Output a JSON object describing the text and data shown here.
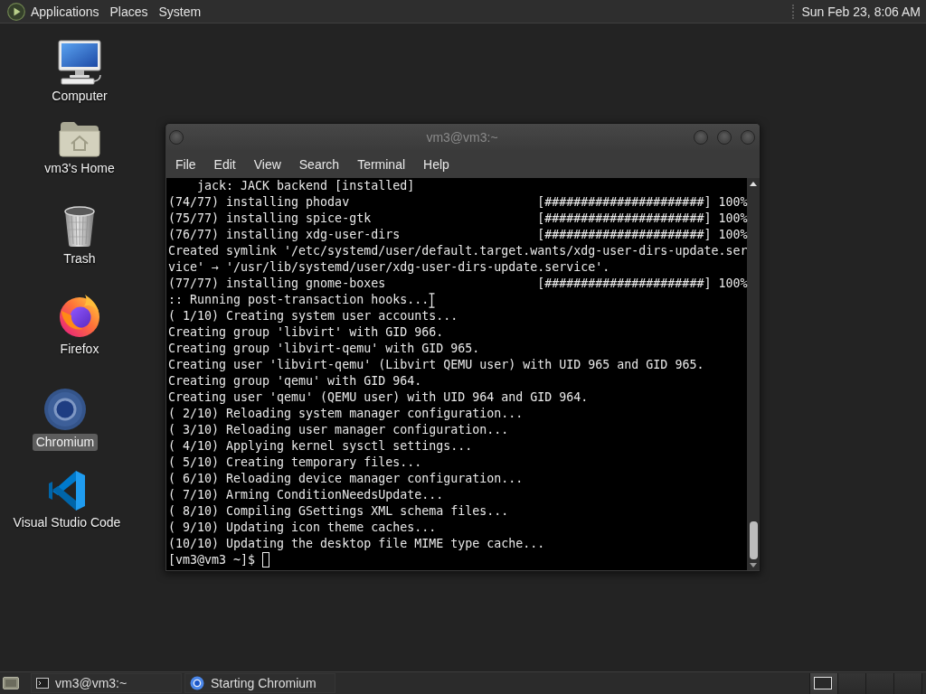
{
  "top_panel": {
    "menus": [
      "Applications",
      "Places",
      "System"
    ],
    "clock": "Sun Feb 23, 8:06 AM"
  },
  "desktop_icons": [
    {
      "kind": "computer",
      "label": "Computer",
      "selected": false
    },
    {
      "kind": "home",
      "label": "vm3's Home",
      "selected": false
    },
    {
      "kind": "trash",
      "label": "Trash",
      "selected": false
    },
    {
      "kind": "firefox",
      "label": "Firefox",
      "selected": false
    },
    {
      "kind": "chromium",
      "label": "Chromium",
      "selected": true
    },
    {
      "kind": "vscode",
      "label": "Visual Studio Code",
      "selected": false
    }
  ],
  "terminal": {
    "title": "vm3@vm3:~",
    "menu": [
      "File",
      "Edit",
      "View",
      "Search",
      "Terminal",
      "Help"
    ],
    "lines": [
      {
        "kind": "detail",
        "text": "jack: JACK backend [installed]"
      },
      {
        "kind": "progress",
        "text": "(74/77) installing phodav",
        "bar": "[######################]",
        "percent": "100%"
      },
      {
        "kind": "progress",
        "text": "(75/77) installing spice-gtk",
        "bar": "[######################]",
        "percent": "100%"
      },
      {
        "kind": "progress",
        "text": "(76/77) installing xdg-user-dirs",
        "bar": "[######################]",
        "percent": "100%"
      },
      {
        "kind": "text",
        "text": "Created symlink '/etc/systemd/user/default.target.wants/xdg-user-dirs-update.ser"
      },
      {
        "kind": "text",
        "text": "vice' → '/usr/lib/systemd/user/xdg-user-dirs-update.service'."
      },
      {
        "kind": "progress",
        "text": "(77/77) installing gnome-boxes",
        "bar": "[######################]",
        "percent": "100%"
      },
      {
        "kind": "text",
        "text": ":: Running post-transaction hooks..."
      },
      {
        "kind": "text",
        "text": "( 1/10) Creating system user accounts..."
      },
      {
        "kind": "text",
        "text": "Creating group 'libvirt' with GID 966."
      },
      {
        "kind": "text",
        "text": "Creating group 'libvirt-qemu' with GID 965."
      },
      {
        "kind": "text",
        "text": "Creating user 'libvirt-qemu' (Libvirt QEMU user) with UID 965 and GID 965."
      },
      {
        "kind": "text",
        "text": "Creating group 'qemu' with GID 964."
      },
      {
        "kind": "text",
        "text": "Creating user 'qemu' (QEMU user) with UID 964 and GID 964."
      },
      {
        "kind": "text",
        "text": "( 2/10) Reloading system manager configuration..."
      },
      {
        "kind": "text",
        "text": "( 3/10) Reloading user manager configuration..."
      },
      {
        "kind": "text",
        "text": "( 4/10) Applying kernel sysctl settings..."
      },
      {
        "kind": "text",
        "text": "( 5/10) Creating temporary files..."
      },
      {
        "kind": "text",
        "text": "( 6/10) Reloading device manager configuration..."
      },
      {
        "kind": "text",
        "text": "( 7/10) Arming ConditionNeedsUpdate..."
      },
      {
        "kind": "text",
        "text": "( 8/10) Compiling GSettings XML schema files..."
      },
      {
        "kind": "text",
        "text": "( 9/10) Updating icon theme caches..."
      },
      {
        "kind": "text",
        "text": "(10/10) Updating the desktop file MIME type cache..."
      },
      {
        "kind": "prompt",
        "text": "[vm3@vm3 ~]$"
      }
    ]
  },
  "bottom_panel": {
    "tasks": [
      {
        "kind": "terminal",
        "label": "vm3@vm3:~"
      },
      {
        "kind": "chromium",
        "label": "Starting Chromium"
      }
    ],
    "workspaces": [
      {
        "selected": true
      },
      {
        "selected": false
      },
      {
        "selected": false
      },
      {
        "selected": false
      }
    ]
  }
}
